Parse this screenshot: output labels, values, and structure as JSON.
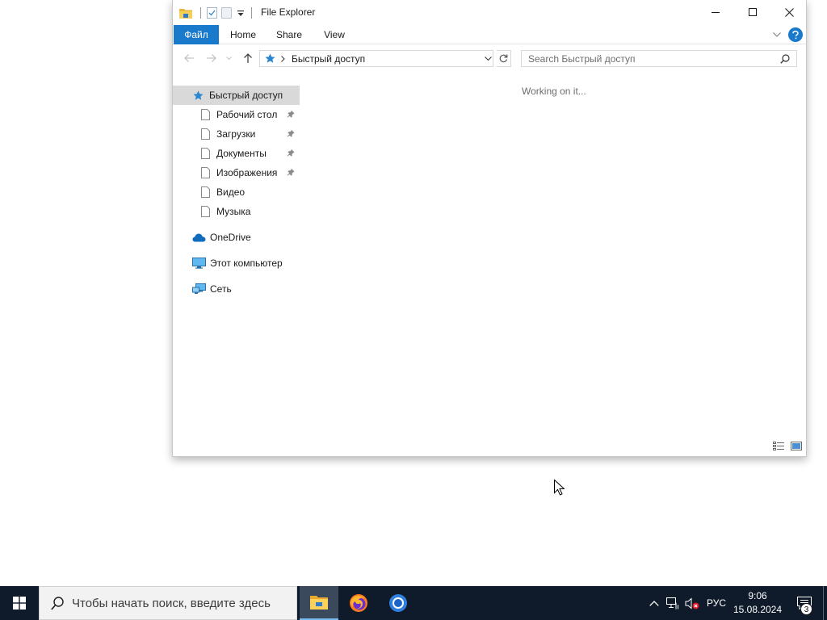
{
  "window": {
    "title": "File Explorer",
    "controls": {
      "minimize": "minimize-icon",
      "maximize": "maximize-icon",
      "close": "close-icon"
    }
  },
  "ribbon": {
    "tabs": [
      {
        "label": "Файл",
        "active": true
      },
      {
        "label": "Home"
      },
      {
        "label": "Share"
      },
      {
        "label": "View"
      }
    ],
    "accent": "#1979ca"
  },
  "navbar": {
    "address": "Быстрый доступ",
    "search_placeholder": "Search Быстрый доступ"
  },
  "navpane": {
    "quick_access": "Быстрый доступ",
    "pinned": [
      {
        "label": "Рабочий стол",
        "pinned": true
      },
      {
        "label": "Загрузки",
        "pinned": true
      },
      {
        "label": "Документы",
        "pinned": true
      },
      {
        "label": "Изображения",
        "pinned": true
      },
      {
        "label": "Видео",
        "pinned": false
      },
      {
        "label": "Музыка",
        "pinned": false
      }
    ],
    "onedrive": "OneDrive",
    "this_pc": "Этот компьютер",
    "network": "Сеть"
  },
  "content": {
    "status": "Working on it..."
  },
  "taskbar": {
    "search_placeholder": "Чтобы начать поиск, введите здесь",
    "apps": [
      {
        "name": "file-explorer",
        "active": true
      },
      {
        "name": "firefox",
        "active": false
      },
      {
        "name": "chrome",
        "active": false
      }
    ],
    "language": "РУС",
    "time": "9:06",
    "date": "15.08.2024",
    "notifications": "3"
  }
}
